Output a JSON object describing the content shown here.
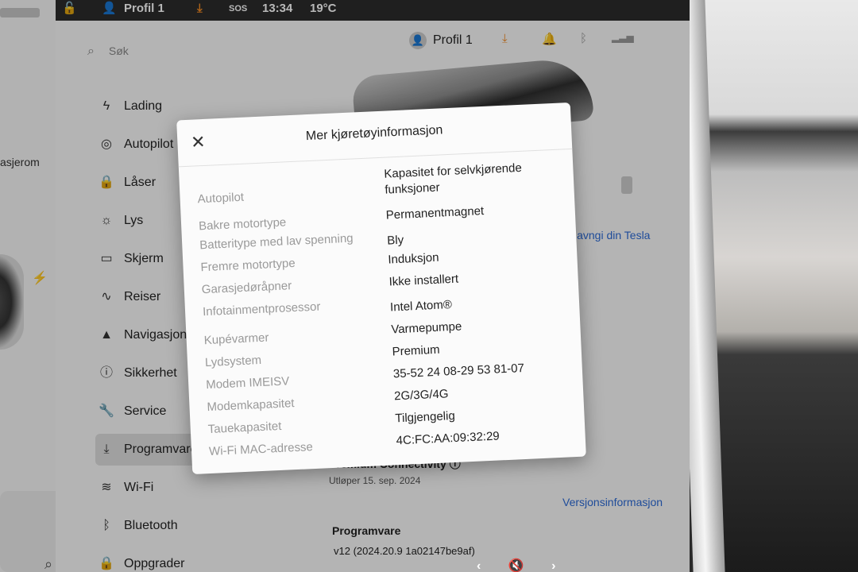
{
  "statusbar": {
    "profile": "Profil 1",
    "sos": "SOS",
    "time": "13:34",
    "temp": "19°C"
  },
  "left_panel": {
    "label": "asjerom"
  },
  "header": {
    "search_placeholder": "Søk",
    "profile": "Profil 1"
  },
  "nav": {
    "items": [
      {
        "label": "Lading",
        "icon": "bolt-icon"
      },
      {
        "label": "Autopilot",
        "icon": "steering-wheel-icon"
      },
      {
        "label": "Låser",
        "icon": "lock-icon"
      },
      {
        "label": "Lys",
        "icon": "sun-icon"
      },
      {
        "label": "Skjerm",
        "icon": "display-icon"
      },
      {
        "label": "Reiser",
        "icon": "trips-icon"
      },
      {
        "label": "Navigasjon",
        "icon": "navigation-icon"
      },
      {
        "label": "Sikkerhet",
        "icon": "safety-icon"
      },
      {
        "label": "Service",
        "icon": "wrench-icon"
      },
      {
        "label": "Programvare",
        "icon": "download-icon"
      },
      {
        "label": "Wi-Fi",
        "icon": "wifi-icon"
      },
      {
        "label": "Bluetooth",
        "icon": "bluetooth-icon"
      },
      {
        "label": "Oppgrader",
        "icon": "bag-icon"
      }
    ]
  },
  "content": {
    "rename_link": "Navngi din Tesla",
    "premium_title": "Premium Connectivity",
    "premium_expiry": "Utløper 15. sep. 2024",
    "version_link": "Versjonsinformasjon",
    "software_title": "Programvare",
    "software_version": "v12 (2024.20.9 1a02147be9af)"
  },
  "modal": {
    "title": "Mer kjøretøyinformasjon",
    "rows": [
      {
        "label": "Autopilot",
        "value": "Kapasitet for selvkjørende funksjoner"
      },
      {
        "label": "Bakre motortype",
        "value": "Permanentmagnet"
      },
      {
        "label": "Batteritype med lav spenning",
        "value": "Bly"
      },
      {
        "label": "Fremre motortype",
        "value": "Induksjon"
      },
      {
        "label": "Garasjedøråpner",
        "value": "Ikke installert"
      },
      {
        "label": "Infotainmentprosessor",
        "value": "Intel Atom®"
      },
      {
        "label": "Kupévarmer",
        "value": "Varmepumpe"
      },
      {
        "label": "Lydsystem",
        "value": "Premium"
      },
      {
        "label": "Modem IMEISV",
        "value": "35-52 24 08-29 53 81-07"
      },
      {
        "label": "Modemkapasitet",
        "value": "2G/3G/4G"
      },
      {
        "label": "Tauekapasitet",
        "value": "Tilgjengelig"
      },
      {
        "label": "Wi-Fi MAC-adresse",
        "value": "4C:FC:AA:09:32:29"
      }
    ]
  }
}
